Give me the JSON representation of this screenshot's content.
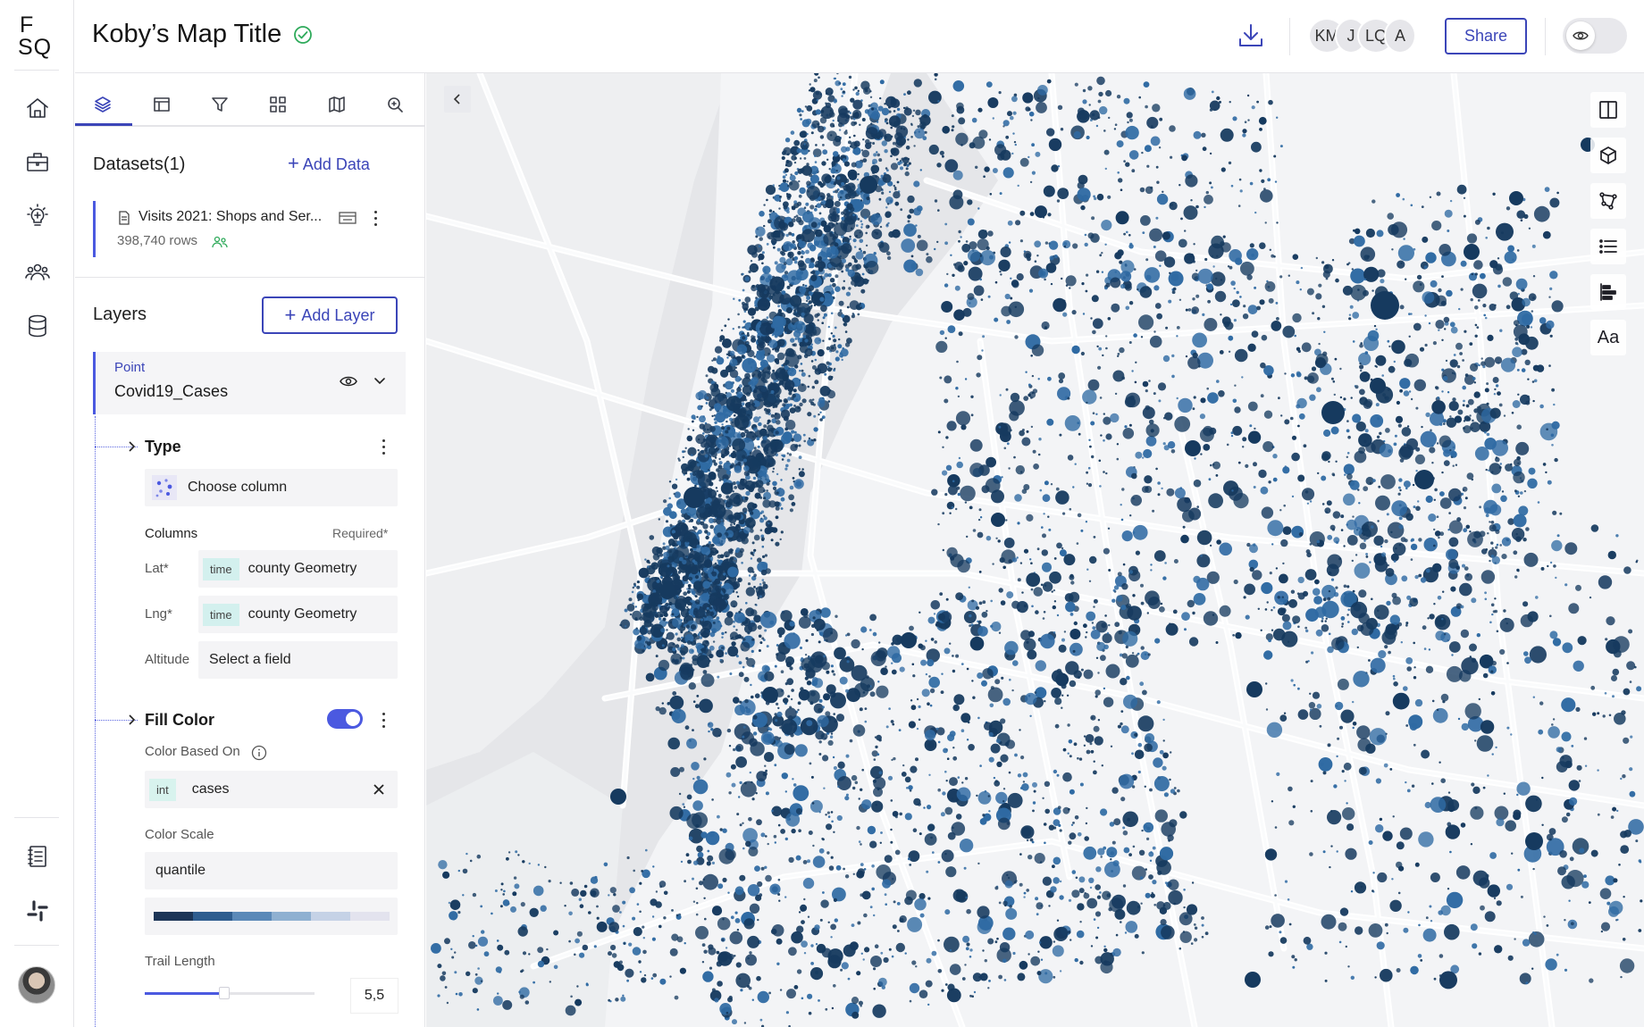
{
  "app": {
    "logo_line1": "F",
    "logo_line2": "SQ"
  },
  "rail": {
    "items": [
      {
        "icon": "home-icon"
      },
      {
        "icon": "briefcase-icon"
      },
      {
        "icon": "lightbulb-icon"
      },
      {
        "icon": "users-icon"
      },
      {
        "icon": "database-icon"
      }
    ],
    "bottom": [
      {
        "icon": "docs-icon"
      },
      {
        "icon": "slack-icon"
      }
    ]
  },
  "header": {
    "title": "Koby’s Map Title",
    "collaborators": [
      "KM",
      "J",
      "LQ",
      "A"
    ],
    "share_label": "Share"
  },
  "panel": {
    "tabs": [
      "layers-icon",
      "table-icon",
      "filter-icon",
      "grid-icon",
      "map-icon",
      "search-icon"
    ],
    "datasets_title": "Datasets(1)",
    "add_data_label": "Add Data",
    "dataset": {
      "name": "Visits 2021: Shops and Ser...",
      "rows": "398,740 rows"
    },
    "layers_title": "Layers",
    "add_layer_label": "Add Layer",
    "layer": {
      "kind": "Point",
      "name": "Covid19_Cases"
    },
    "type_section": {
      "title": "Type",
      "choose_label": "Choose column"
    },
    "columns": {
      "title": "Columns",
      "required": "Required*",
      "lat_label": "Lat*",
      "lat_tag": "time",
      "lat_value": "county Geometry",
      "lng_label": "Lng*",
      "lng_tag": "time",
      "lng_value": "county Geometry",
      "alt_label": "Altitude",
      "alt_value": "Select a field"
    },
    "fill_color": {
      "title": "Fill Color",
      "enabled": true,
      "based_on_label": "Color Based On",
      "field_tag": "int",
      "field_value": "cases",
      "scale_label": "Color Scale",
      "scale_value": "quantile",
      "ramp": [
        "#1d3557",
        "#2f5d8f",
        "#5b89b8",
        "#8fb0d1",
        "#c5d2e6",
        "#e3e3ee"
      ]
    },
    "trail": {
      "label": "Trail Length",
      "value": "5,5",
      "fill_fraction": 0.47
    }
  },
  "map": {
    "point_color": "#163a5f",
    "point_color_light": "#2f6aa3",
    "tools": [
      "split-map-icon",
      "3d-cube-icon",
      "draw-polygon-icon",
      "legend-list-icon",
      "bar-align-icon",
      "text-label-icon"
    ],
    "text_tool_label": "Aa"
  },
  "colors": {
    "accent": "#3b45b8",
    "accent_light": "#4b59e0",
    "verified": "#2eaa5a"
  }
}
